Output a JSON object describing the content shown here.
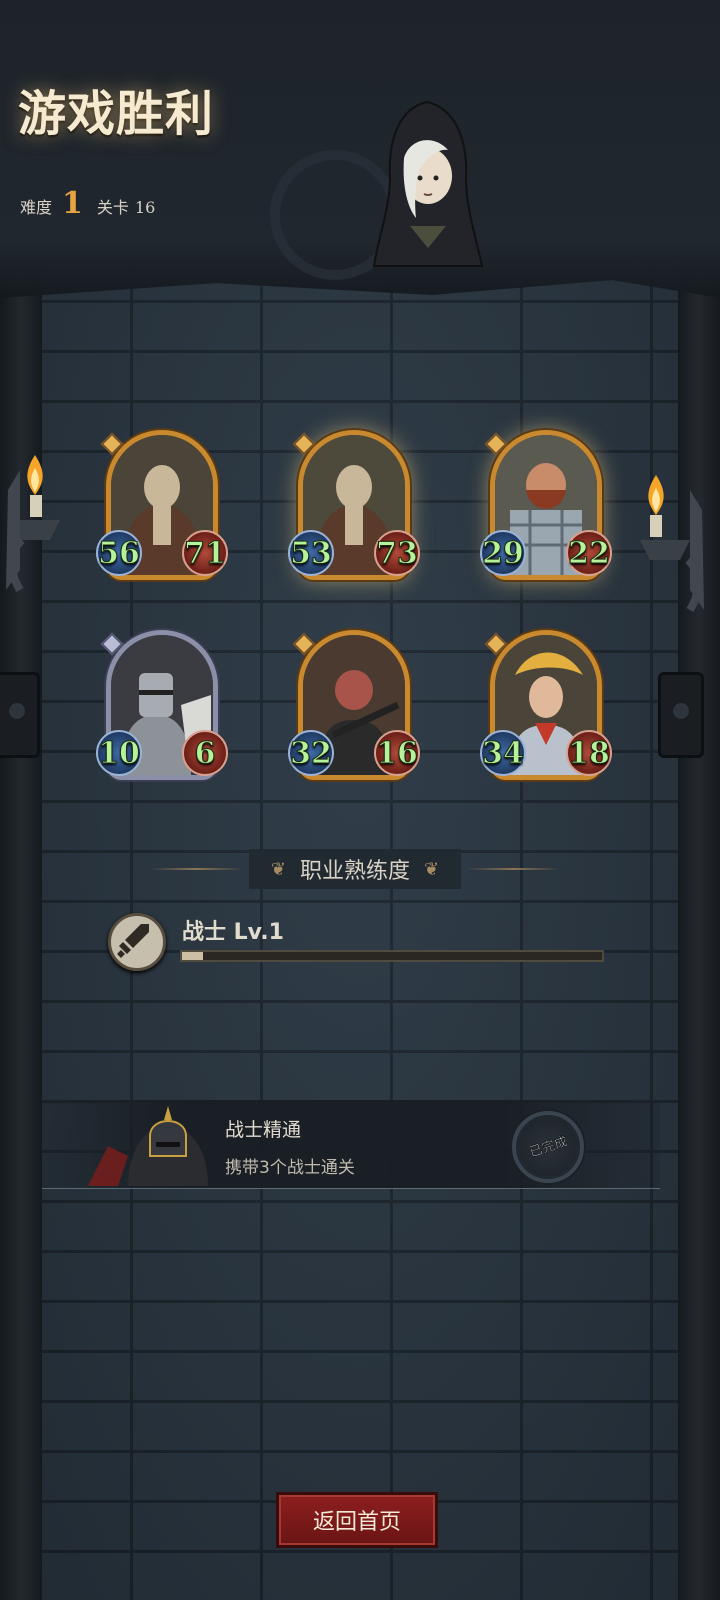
{
  "header": {
    "title": "游戏胜利",
    "difficulty_label": "难度",
    "difficulty_value": "1",
    "stage_label": "关卡",
    "stage_value": "16"
  },
  "party": [
    {
      "attack": "56",
      "health": "71",
      "frame": "gold"
    },
    {
      "attack": "53",
      "health": "73",
      "frame": "gold"
    },
    {
      "attack": "29",
      "health": "22",
      "frame": "gold"
    },
    {
      "attack": "10",
      "health": "6",
      "frame": "silver"
    },
    {
      "attack": "32",
      "health": "16",
      "frame": "gold"
    },
    {
      "attack": "34",
      "health": "18",
      "frame": "gold"
    }
  ],
  "proficiency": {
    "heading": "职业熟练度",
    "class_name": "战士 Lv.1",
    "class_icon": "sword-icon",
    "progress_percent": 5
  },
  "achievement": {
    "title": "战士精通",
    "description": "携带3个战士通关",
    "status": "已完成"
  },
  "footer": {
    "return_label": "返回首页"
  },
  "colors": {
    "accent_gold": "#e8a342",
    "button_red": "#8d1f1f",
    "stat_green": "#b6f29a"
  }
}
